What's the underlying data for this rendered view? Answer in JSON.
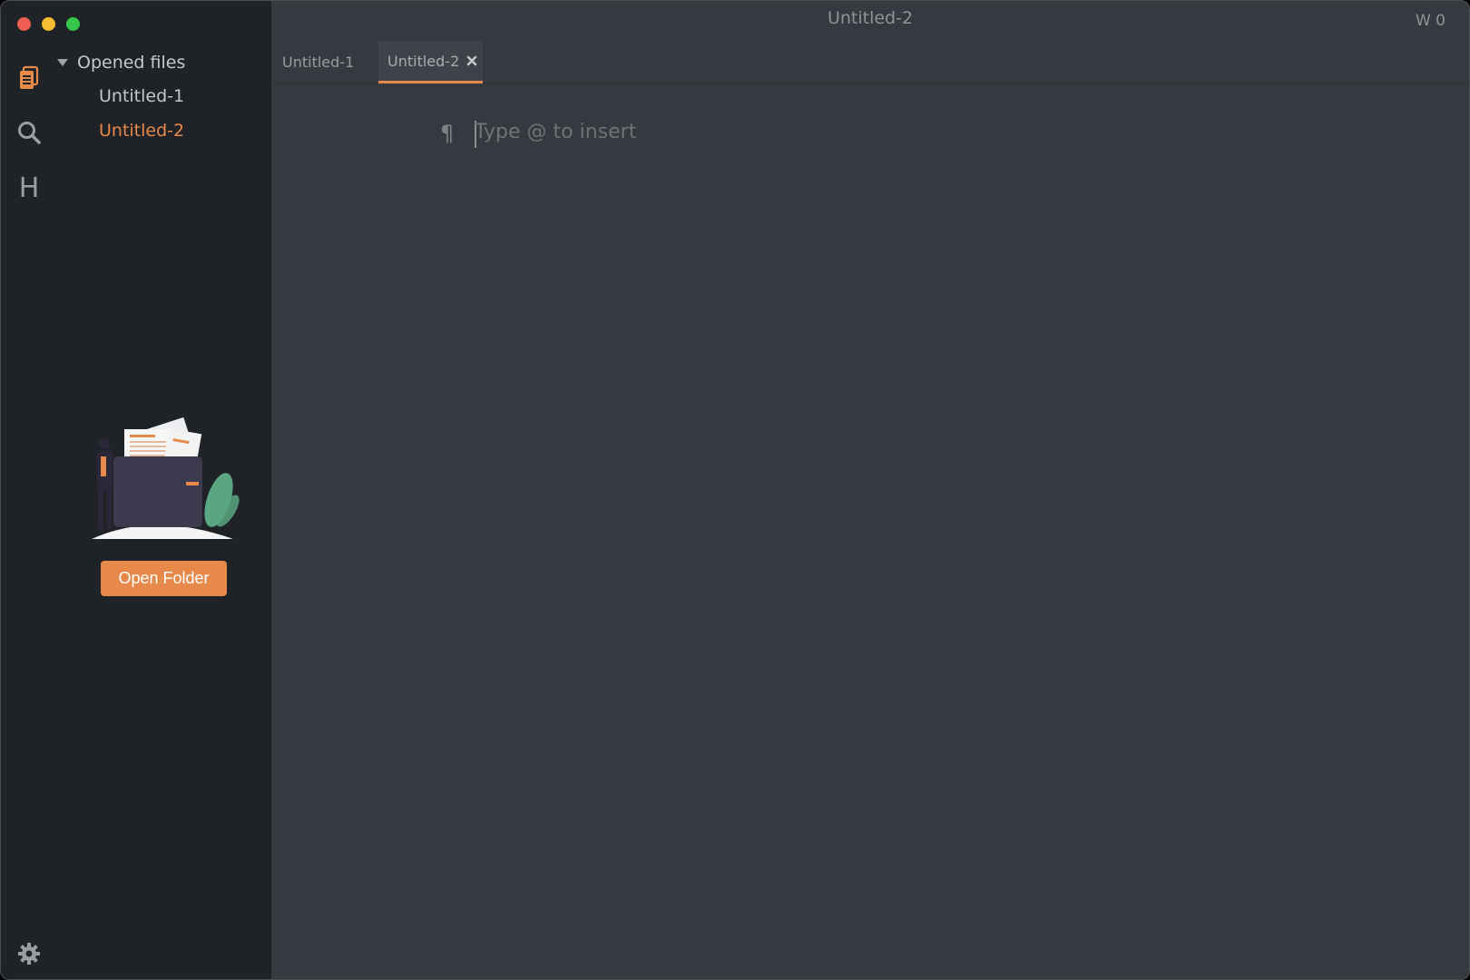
{
  "window": {
    "title": "Untitled-2",
    "word_count": "W 0"
  },
  "colors": {
    "accent": "#e6894a",
    "traffic_close": "#ee5e55",
    "traffic_minimize": "#f5bd2f",
    "traffic_maximize": "#35c84a",
    "plant": "#5ba682"
  },
  "sidebar": {
    "activity_icons": [
      "files-icon",
      "search-icon",
      "toc-icon",
      "gear-icon"
    ],
    "toc_glyph": "H",
    "section_title": "Opened files",
    "files": [
      {
        "name": "Untitled-1",
        "active": false
      },
      {
        "name": "Untitled-2",
        "active": true
      }
    ],
    "open_folder_label": "Open Folder"
  },
  "tabs": [
    {
      "label": "Untitled-1",
      "active": false
    },
    {
      "label": "Untitled-2",
      "active": true
    }
  ],
  "editor": {
    "paragraph_marker": "¶",
    "placeholder": "Type @ to insert"
  }
}
